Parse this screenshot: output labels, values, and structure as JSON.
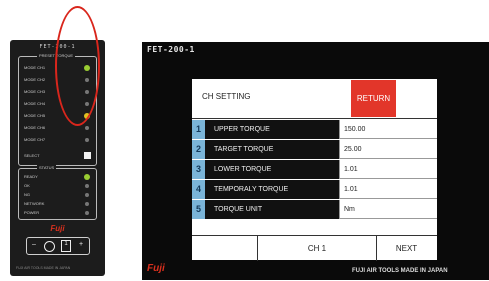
{
  "device": {
    "title": "FET-200-1",
    "top_panel_label": "PRESET TORQUE",
    "channels": [
      "MODE CH1",
      "MODE CH2",
      "MODE CH3",
      "MODE CH4",
      "MODE CH5",
      "MODE CH6",
      "MODE CH7",
      "MODE CH8"
    ],
    "select_label": "SELECT",
    "status_panel_label": "STATUS",
    "status_items": [
      "READY",
      "OK",
      "NG",
      "NETWORK",
      "POWER"
    ],
    "brand": "Fuji",
    "ch_minus": "–",
    "ch_number": "1",
    "ch_plus": "+",
    "footer": "FUJI AIR TOOLS    MADE IN JAPAN"
  },
  "screen": {
    "title": "FET-200-1",
    "heading": "CH SETTING",
    "return_label": "RETURN",
    "params": [
      {
        "num": "1",
        "name": "UPPER TORQUE",
        "value": "150.00"
      },
      {
        "num": "2",
        "name": "TARGET TORQUE",
        "value": "25.00"
      },
      {
        "num": "3",
        "name": "LOWER TORQUE",
        "value": "1.01"
      },
      {
        "num": "4",
        "name": "TEMPORALY TORQUE",
        "value": "1.01"
      },
      {
        "num": "5",
        "name": "TORQUE UNIT",
        "value": "Nm"
      }
    ],
    "channel_label": "CH 1",
    "next_label": "NEXT",
    "brand": "Fuji",
    "footer": "FUJI AIR TOOLS  MADE IN JAPAN"
  },
  "colors": {
    "return_button": "#e2362a",
    "index_cell": "#7ab4d8",
    "callout": "#d9261c",
    "brand": "#d9301e"
  }
}
